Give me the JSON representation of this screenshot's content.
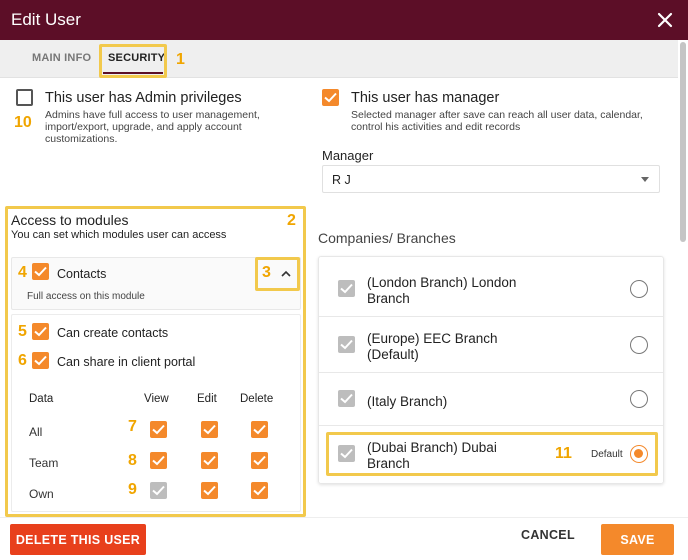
{
  "window": {
    "title": "Edit User",
    "close_icon": "close-icon"
  },
  "tabs": [
    {
      "label": "MAIN INFO",
      "active": false
    },
    {
      "label": "SECURITY",
      "active": true
    }
  ],
  "annotations": [
    "1",
    "2",
    "3",
    "4",
    "5",
    "6",
    "7",
    "8",
    "9",
    "10",
    "11"
  ],
  "admin": {
    "label": "This user has Admin privileges",
    "checked": false,
    "description_line1": "Admins have full access to user management,",
    "description_line2": "import/export, upgrade, and apply account",
    "description_line3": "customizations."
  },
  "manager_option": {
    "label": "This user has manager",
    "checked": true,
    "description_line1": "Selected manager after save can reach all user data, calendar,",
    "description_line2": "control his activities and edit records"
  },
  "manager_field": {
    "label": "Manager",
    "value": "R J"
  },
  "modules": {
    "title": "Access to modules",
    "subtitle": "You can set which modules user can access",
    "contacts": {
      "label": "Contacts",
      "checked": true,
      "note": "Full access on this module"
    },
    "can_create": {
      "label": "Can create contacts",
      "checked": true
    },
    "can_share": {
      "label": "Can share in client portal",
      "checked": true
    },
    "permissions": {
      "headers": [
        "Data",
        "View",
        "Edit",
        "Delete"
      ],
      "rows": [
        {
          "label": "All",
          "view": "checked",
          "edit": "checked",
          "delete": "checked"
        },
        {
          "label": "Team",
          "view": "checked",
          "edit": "checked",
          "delete": "checked"
        },
        {
          "label": "Own",
          "view": "disabled",
          "edit": "checked",
          "delete": "checked"
        }
      ]
    }
  },
  "branches": {
    "heading": "Companies/ Branches",
    "items": [
      {
        "line1": "(London Branch) London",
        "line2": "Branch",
        "selected": false
      },
      {
        "line1": "(Europe) EEC Branch",
        "line2": "(Default)",
        "selected": false
      },
      {
        "line1": "(Italy Branch)",
        "line2": "",
        "selected": false
      },
      {
        "line1": "(Dubai Branch) Dubai",
        "line2": "Branch",
        "selected": true,
        "badge": "Default"
      }
    ]
  },
  "footer": {
    "delete_label": "DELETE THIS USER",
    "cancel_label": "CANCEL",
    "save_label": "SAVE"
  },
  "colors": {
    "title_bar": "#5c0e27",
    "accent": "#f4892b",
    "annotation": "#f2c94c",
    "delete": "#e8401c"
  }
}
